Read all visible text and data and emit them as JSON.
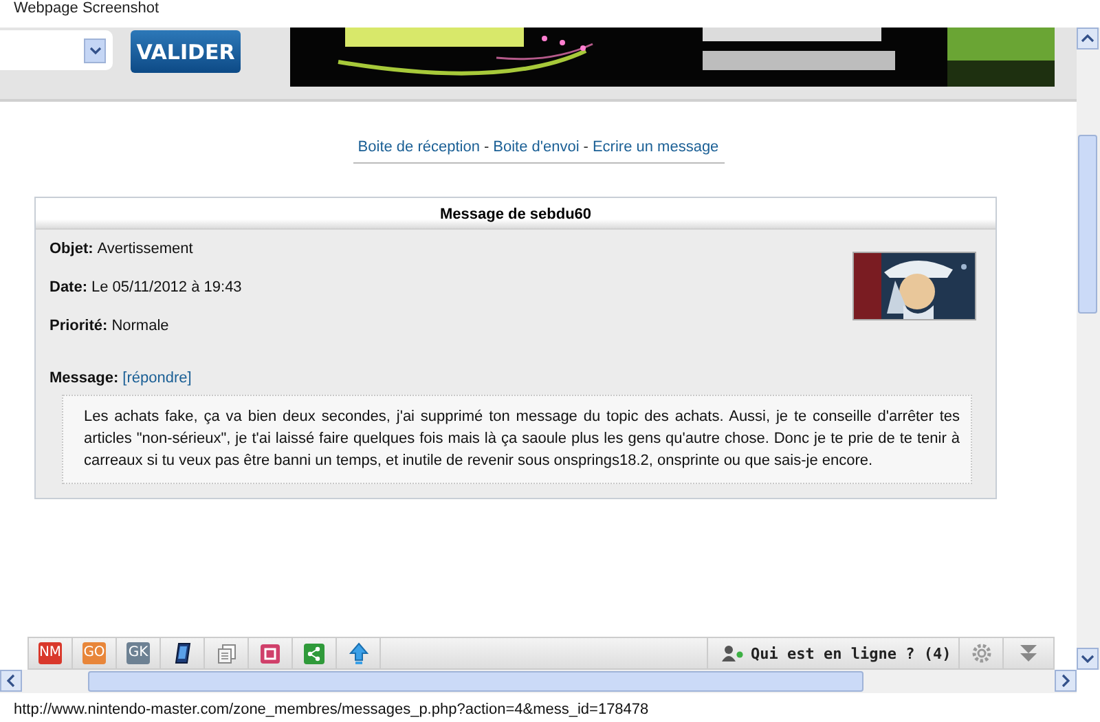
{
  "window": {
    "title": "Webpage Screenshot"
  },
  "header": {
    "button": "VALIDER"
  },
  "nav": [
    {
      "kind": "link",
      "text": "Boite de réception"
    },
    {
      "kind": "sep",
      "text": "-"
    },
    {
      "kind": "link",
      "text": "Boite d'envoi"
    },
    {
      "kind": "sep",
      "text": "-"
    },
    {
      "kind": "link",
      "text": "Ecrire un message"
    }
  ],
  "message": {
    "title": "Message de sebdu60",
    "fields": [
      {
        "label": "Objet:",
        "value": "Avertissement"
      },
      {
        "label": "Date:",
        "value": "Le 05/11/2012 à 19:43"
      },
      {
        "label": "Priorité:",
        "value": "Normale"
      }
    ],
    "message_label": "Message:",
    "reply_link": "[répondre]",
    "body": "Les achats fake, ça va bien deux secondes, j'ai supprimé ton message du topic des achats. Aussi, je te conseille d'arrêter tes articles \"non-sérieux\", je t'ai laissé faire quelques fois mais là ça saoule plus les gens qu'autre chose. Donc je te prie de te tenir à carreaux si tu veux pas être banni un temps, et inutile de revenir sous onsprings18.2, onsprinte ou que sais-je encore."
  },
  "toolbar": {
    "buttons": [
      {
        "kind": "badge",
        "label": "NM",
        "color": "#d9382b"
      },
      {
        "kind": "badge",
        "label": "GO",
        "color": "#e8863a"
      },
      {
        "kind": "badge",
        "label": "GK",
        "color": "#6d8193"
      },
      {
        "kind": "phone"
      },
      {
        "kind": "pages"
      },
      {
        "kind": "save"
      },
      {
        "kind": "share"
      },
      {
        "kind": "up"
      }
    ],
    "online": "Qui est en ligne ? (4)"
  },
  "status_bar": "http://www.nintendo-master.com/zone_membres/messages_p.php?action=4&mess_id=178478"
}
